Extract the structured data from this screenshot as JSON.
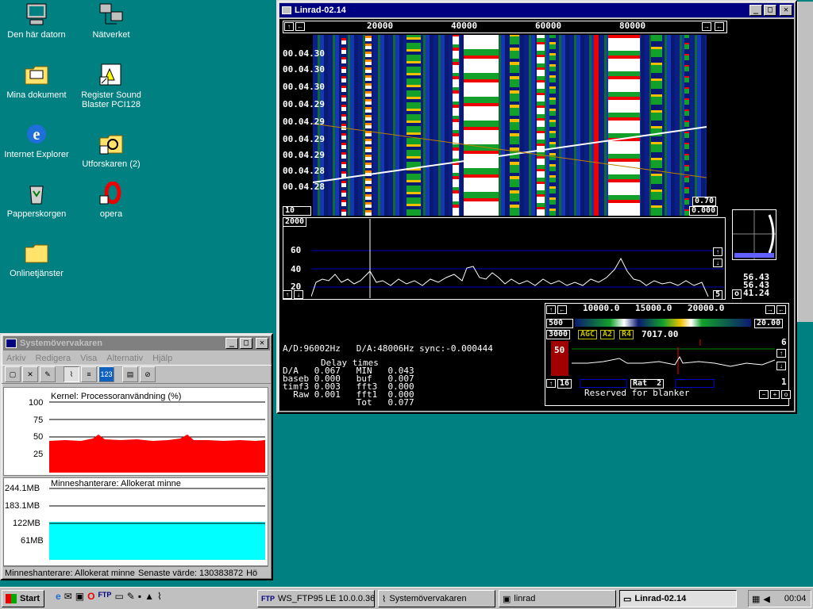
{
  "desktop": {
    "icons": [
      {
        "label": "Den här datorn",
        "icon": "computer-icon"
      },
      {
        "label": "Nätverket",
        "icon": "network-icon"
      },
      {
        "label": "Mina dokument",
        "icon": "folder-docs-icon"
      },
      {
        "label": "Register Sound Blaster PCI128",
        "icon": "shortcut-icon"
      },
      {
        "label": "Internet Explorer",
        "icon": "ie-icon"
      },
      {
        "label": "Utforskaren (2)",
        "icon": "explorer-icon"
      },
      {
        "label": "Papperskorgen",
        "icon": "recycle-bin-icon"
      },
      {
        "label": "opera",
        "icon": "opera-icon"
      },
      {
        "label": "Onlinetjänster",
        "icon": "folder-icon"
      }
    ]
  },
  "linrad": {
    "title": "Linrad-02.14",
    "freq_ticks": [
      "20000",
      "40000",
      "60000",
      "80000"
    ],
    "time_labels": [
      "00.04.30",
      "00.04.30",
      "00.04.30",
      "00.04.29",
      "00.04.29",
      "00.04.29",
      "00.04.29",
      "00.04.28",
      "00.04.28"
    ],
    "wf_corner_left": "10",
    "wf_val_1": "0.70",
    "wf_val_2": "0.000",
    "spec_top": "2000",
    "spec_levels": [
      "60",
      "40",
      "20"
    ],
    "spec_right": "5",
    "ad_line": "A/D:96002Hz   D/A:48006Hz sync:-0.000444",
    "delay_title": "Delay times",
    "delay_rows": [
      "D/A   0.067   MIN   0.043",
      "baseb 0.000   buf   0.007",
      "timf3 0.003   fft3  0.000",
      "  Raw 0.001   fft1  0.000",
      "              Tot   0.077"
    ],
    "pol_values": [
      "56.43",
      "56.43",
      "41.24"
    ],
    "pol_o": "o",
    "bl_ticks": [
      "10000.0",
      "15000.0",
      "20000.0"
    ],
    "bl_500": "500",
    "bl_20": "20.00",
    "bl_3000": "3000",
    "agc": "AGC",
    "a2": "A2",
    "r4": "R4",
    "bl_freq": "7017.00",
    "bl_50": "50",
    "bl_6": "6",
    "bl_1": "1",
    "bl_16": "16",
    "rat": "Rat  2",
    "blanker": "Reserved for blanker"
  },
  "sysmon": {
    "title": "Systemövervakaren",
    "menu": [
      "Arkiv",
      "Redigera",
      "Visa",
      "Alternativ",
      "Hjälp"
    ],
    "chart1_title": "Kernel: Processoranvändning (%)",
    "chart1_axis": [
      "100",
      "75",
      "50",
      "25"
    ],
    "chart2_title": "Minneshanterare: Allokerat minne",
    "chart2_axis": [
      "244.1MB",
      "183.1MB",
      "122MB",
      "61MB"
    ],
    "status_left": "Minneshanterare: Allokerat minne",
    "status_right": "Senaste värde: 130383872",
    "status_tail": "Hö",
    "cpu_level_pct": 45,
    "mem_level_pct": 52
  },
  "taskbar": {
    "start": "Start",
    "tasks": [
      {
        "label": "WS_FTP95 LE 10.0.0.36"
      },
      {
        "label": "Systemövervakaren"
      },
      {
        "label": "linrad"
      },
      {
        "label": "Linrad-02.14"
      }
    ],
    "clock": "00:04"
  },
  "colors": {
    "desktop": "#008080",
    "title_active": "#000080",
    "cpu_fill": "#ff0000",
    "mem_fill": "#00ffff"
  }
}
